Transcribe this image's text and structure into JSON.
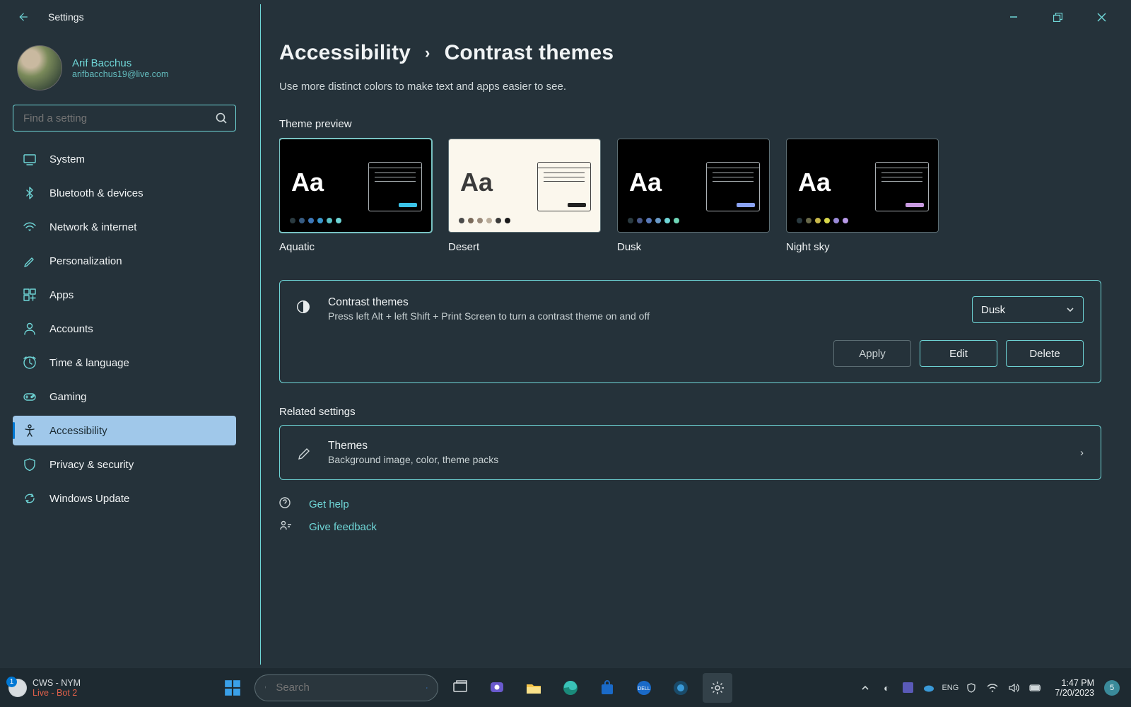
{
  "window": {
    "app_title": "Settings",
    "min_tooltip": "Minimize",
    "max_tooltip": "Maximize",
    "close_tooltip": "Close"
  },
  "user": {
    "name": "Arif Bacchus",
    "email": "arifbacchus19@live.com"
  },
  "search": {
    "placeholder": "Find a setting"
  },
  "sidebar": {
    "items": [
      {
        "label": "System",
        "icon": "system"
      },
      {
        "label": "Bluetooth & devices",
        "icon": "bluetooth"
      },
      {
        "label": "Network & internet",
        "icon": "wifi"
      },
      {
        "label": "Personalization",
        "icon": "brush"
      },
      {
        "label": "Apps",
        "icon": "apps"
      },
      {
        "label": "Accounts",
        "icon": "person"
      },
      {
        "label": "Time & language",
        "icon": "time"
      },
      {
        "label": "Gaming",
        "icon": "gaming"
      },
      {
        "label": "Accessibility",
        "icon": "accessibility",
        "selected": true
      },
      {
        "label": "Privacy & security",
        "icon": "shield"
      },
      {
        "label": "Windows Update",
        "icon": "update"
      }
    ]
  },
  "breadcrumb": {
    "parent": "Accessibility",
    "current": "Contrast themes"
  },
  "subtitle": "Use more distinct colors to make text and apps easier to see.",
  "preview_label": "Theme preview",
  "themes": [
    {
      "name": "Aquatic",
      "bg": "dark",
      "selected": true,
      "text": "#fff",
      "win": "#9aa0a4",
      "btn": "#3ac2e6",
      "dots": [
        "#2a3a40",
        "#375b82",
        "#3d77b8",
        "#3a96cc",
        "#5ac2c8",
        "#6fd6d7"
      ]
    },
    {
      "name": "Desert",
      "bg": "light",
      "text": "#3a3a3a",
      "win": "#444",
      "btn": "#222",
      "dots": [
        "#4a4a4a",
        "#7a6a5a",
        "#9a8a7a",
        "#bcae9c",
        "#3a3a3a",
        "#1a1a1a"
      ]
    },
    {
      "name": "Dusk",
      "bg": "dark",
      "text": "#fff",
      "win": "#9aa0a4",
      "btn": "#8aa2f2",
      "dots": [
        "#2a3a40",
        "#4a5a8a",
        "#5a7aba",
        "#6a9ac8",
        "#6fd6d7",
        "#6fd6b7"
      ]
    },
    {
      "name": "Night sky",
      "bg": "dark",
      "text": "#fff",
      "win": "#9aa0a4",
      "btn": "#c89ae0",
      "dots": [
        "#2a3a40",
        "#6a6a4a",
        "#c8b84a",
        "#d8d84a",
        "#9a8ad8",
        "#b89ae8"
      ]
    }
  ],
  "contrast_card": {
    "title": "Contrast themes",
    "desc": "Press left Alt + left Shift + Print Screen to turn a contrast theme on and off",
    "select_value": "Dusk",
    "apply": "Apply",
    "edit": "Edit",
    "delete": "Delete"
  },
  "related": {
    "label": "Related settings",
    "themes_title": "Themes",
    "themes_desc": "Background image, color, theme packs"
  },
  "help": {
    "get_help": "Get help",
    "feedback": "Give feedback"
  },
  "taskbar": {
    "vpn_line1": "CWS - NYM",
    "vpn_line2": "Live - Bot 2",
    "vpn_badge": "1",
    "search_placeholder": "Search",
    "time": "1:47 PM",
    "date": "7/20/2023",
    "notif_badge": "5"
  }
}
